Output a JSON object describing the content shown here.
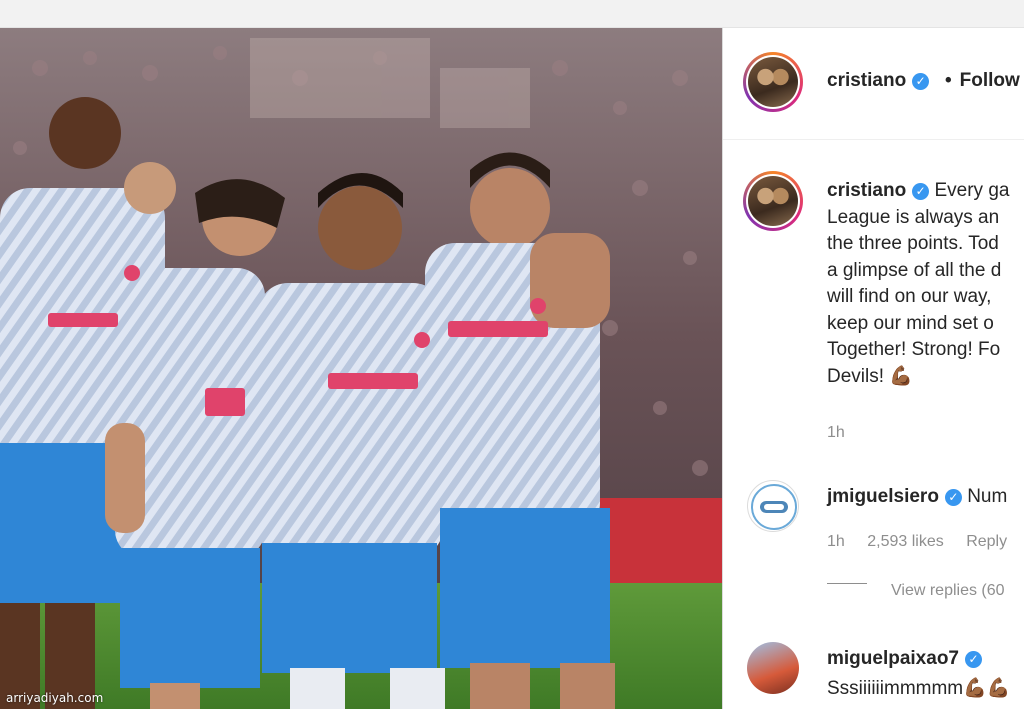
{
  "post": {
    "author": "cristiano",
    "follow_label": "Follow",
    "watermark": "arriyadiyah.com"
  },
  "caption": {
    "author": "cristiano",
    "lines": [
      "Every ga",
      "League is always an ",
      "the three points. Tod",
      "a glimpse of all the d",
      "will find on our way, ",
      "keep our mind set o",
      "Together! Strong! Fo",
      "Devils!"
    ],
    "time": "1h"
  },
  "comments": [
    {
      "username": "jmiguelsiero",
      "text": "Num",
      "time": "1h",
      "likes": "2,593 likes",
      "reply_label": "Reply",
      "view_replies": "View replies (60"
    },
    {
      "username": "miguelpaixao7",
      "text": "Sssiiiiiimmmmm"
    }
  ],
  "colors": {
    "verified": "#3897f0",
    "story_ring": [
      "#f58529",
      "#dd2a7b",
      "#8134af"
    ],
    "secondary_text": "#8e8e8e"
  }
}
